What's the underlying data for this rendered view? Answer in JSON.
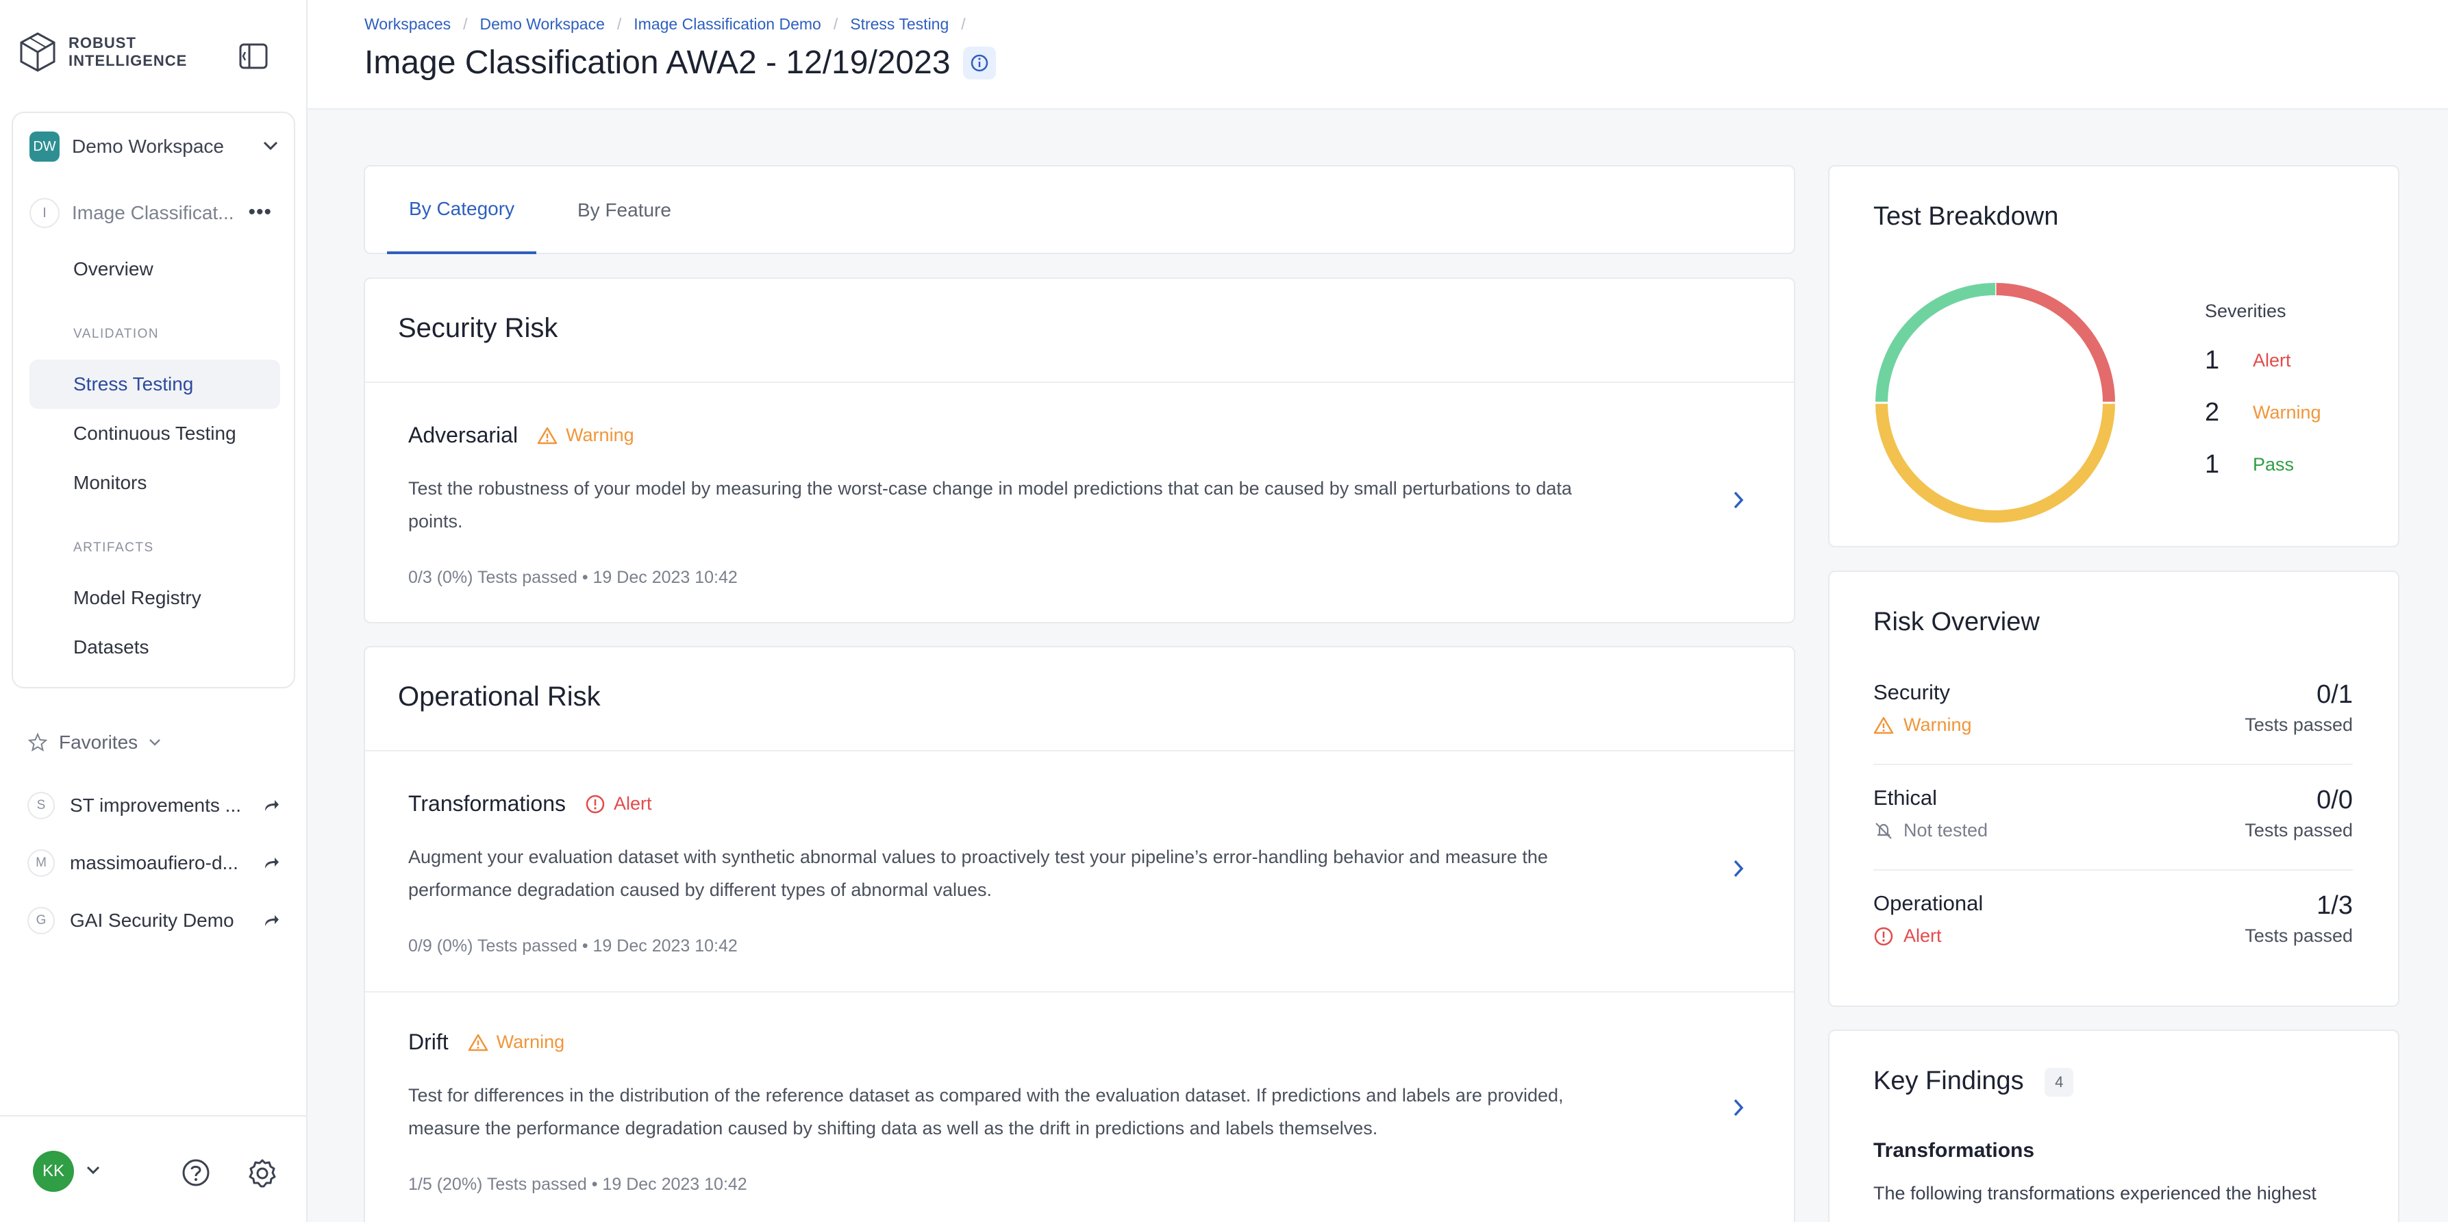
{
  "brand": {
    "line1": "ROBUST",
    "line2": "INTELLIGENCE"
  },
  "workspace": {
    "initials": "DW",
    "name": "Demo Workspace"
  },
  "project": {
    "initial": "I",
    "name": "Image Classificat..."
  },
  "nav": {
    "overview": "Overview",
    "validation_section": "VALIDATION",
    "stress_testing": "Stress Testing",
    "continuous_testing": "Continuous Testing",
    "monitors": "Monitors",
    "artifacts_section": "ARTIFACTS",
    "model_registry": "Model Registry",
    "datasets": "Datasets"
  },
  "favorites": {
    "label": "Favorites",
    "items": [
      {
        "initial": "S",
        "name": "ST improvements ..."
      },
      {
        "initial": "M",
        "name": "massimoaufiero-d..."
      },
      {
        "initial": "G",
        "name": "GAI Security Demo"
      }
    ]
  },
  "user": {
    "initials": "KK"
  },
  "breadcrumb": [
    "Workspaces",
    "Demo Workspace",
    "Image Classification Demo",
    "Stress Testing"
  ],
  "page_title": "Image Classification AWA2 - 12/19/2023",
  "tabs": {
    "by_category": "By Category",
    "by_feature": "By Feature"
  },
  "security_risk": {
    "title": "Security Risk",
    "items": [
      {
        "name": "Adversarial",
        "severity": "Warning",
        "desc1": "Test the robustness of your model by measuring the worst-case change in model predictions that can be caused by small perturbations to data",
        "desc2": "points.",
        "meta": "0/3 (0%) Tests passed  •  19 Dec 2023 10:42"
      }
    ]
  },
  "operational_risk": {
    "title": "Operational Risk",
    "items": [
      {
        "name": "Transformations",
        "severity": "Alert",
        "desc1": "Augment your evaluation dataset with synthetic abnormal values to proactively test your pipeline’s error-handling behavior and measure the",
        "desc2": "performance degradation caused by different types of abnormal values.",
        "meta": "0/9 (0%) Tests passed  •  19 Dec 2023 10:42"
      },
      {
        "name": "Drift",
        "severity": "Warning",
        "desc1": "Test for differences in the distribution of the reference dataset as compared with the evaluation dataset. If predictions and labels are provided,",
        "desc2": "measure the performance degradation caused by shifting data as well as the drift in predictions and labels themselves.",
        "meta": "1/5 (20%) Tests passed  •  19 Dec 2023 10:42"
      }
    ]
  },
  "test_breakdown": {
    "title": "Test Breakdown",
    "legend_title": "Severities",
    "colors": {
      "alert": "#e46b6b",
      "warning": "#f2c14e",
      "pass": "#6fd3a0"
    },
    "rows": [
      {
        "count": "1",
        "label": "Alert"
      },
      {
        "count": "2",
        "label": "Warning"
      },
      {
        "count": "1",
        "label": "Pass"
      }
    ]
  },
  "chart_data": {
    "type": "pie",
    "categories": [
      "Alert",
      "Warning",
      "Pass"
    ],
    "values": [
      1,
      2,
      1
    ],
    "title": "Test Breakdown"
  },
  "risk_overview": {
    "title": "Risk Overview",
    "rows": [
      {
        "name": "Security",
        "status": "Warning",
        "score": "0/1",
        "sub": "Tests passed"
      },
      {
        "name": "Ethical",
        "status": "Not tested",
        "score": "0/0",
        "sub": "Tests passed"
      },
      {
        "name": "Operational",
        "status": "Alert",
        "score": "1/3",
        "sub": "Tests passed"
      }
    ]
  },
  "key_findings": {
    "title": "Key Findings",
    "count": "4",
    "subtitle": "Transformations",
    "text": "The following transformations experienced the highest"
  }
}
